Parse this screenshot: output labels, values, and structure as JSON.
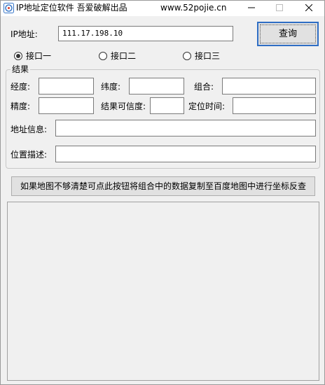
{
  "window": {
    "title": "IP地址定位软件   吾爱破解出品",
    "site": "www.52pojie.cn"
  },
  "ip": {
    "label": "IP地址:",
    "value": "111.17.198.10"
  },
  "query_button": "查询",
  "interfaces": [
    {
      "label": "接口一",
      "checked": true
    },
    {
      "label": "接口二",
      "checked": false
    },
    {
      "label": "接口三",
      "checked": false
    }
  ],
  "result": {
    "group_title": "结果",
    "longitude_label": "经度:",
    "longitude_value": "",
    "latitude_label": "纬度:",
    "latitude_value": "",
    "combined_label": "组合:",
    "combined_value": "",
    "precision_label": "精度:",
    "precision_value": "",
    "confidence_label": "结果可信度:",
    "confidence_value": "",
    "locate_time_label": "定位时间:",
    "locate_time_value": "",
    "address_label": "地址信息:",
    "address_value": "",
    "description_label": "位置描述:",
    "description_value": ""
  },
  "copy_button": "如果地图不够清楚可点此按钮将组合中的数据复制至百度地图中进行坐标反查",
  "colors": {
    "background": "#f0f0f0",
    "focus_border": "#2f6ec4",
    "input_border": "#7a7a7a"
  }
}
